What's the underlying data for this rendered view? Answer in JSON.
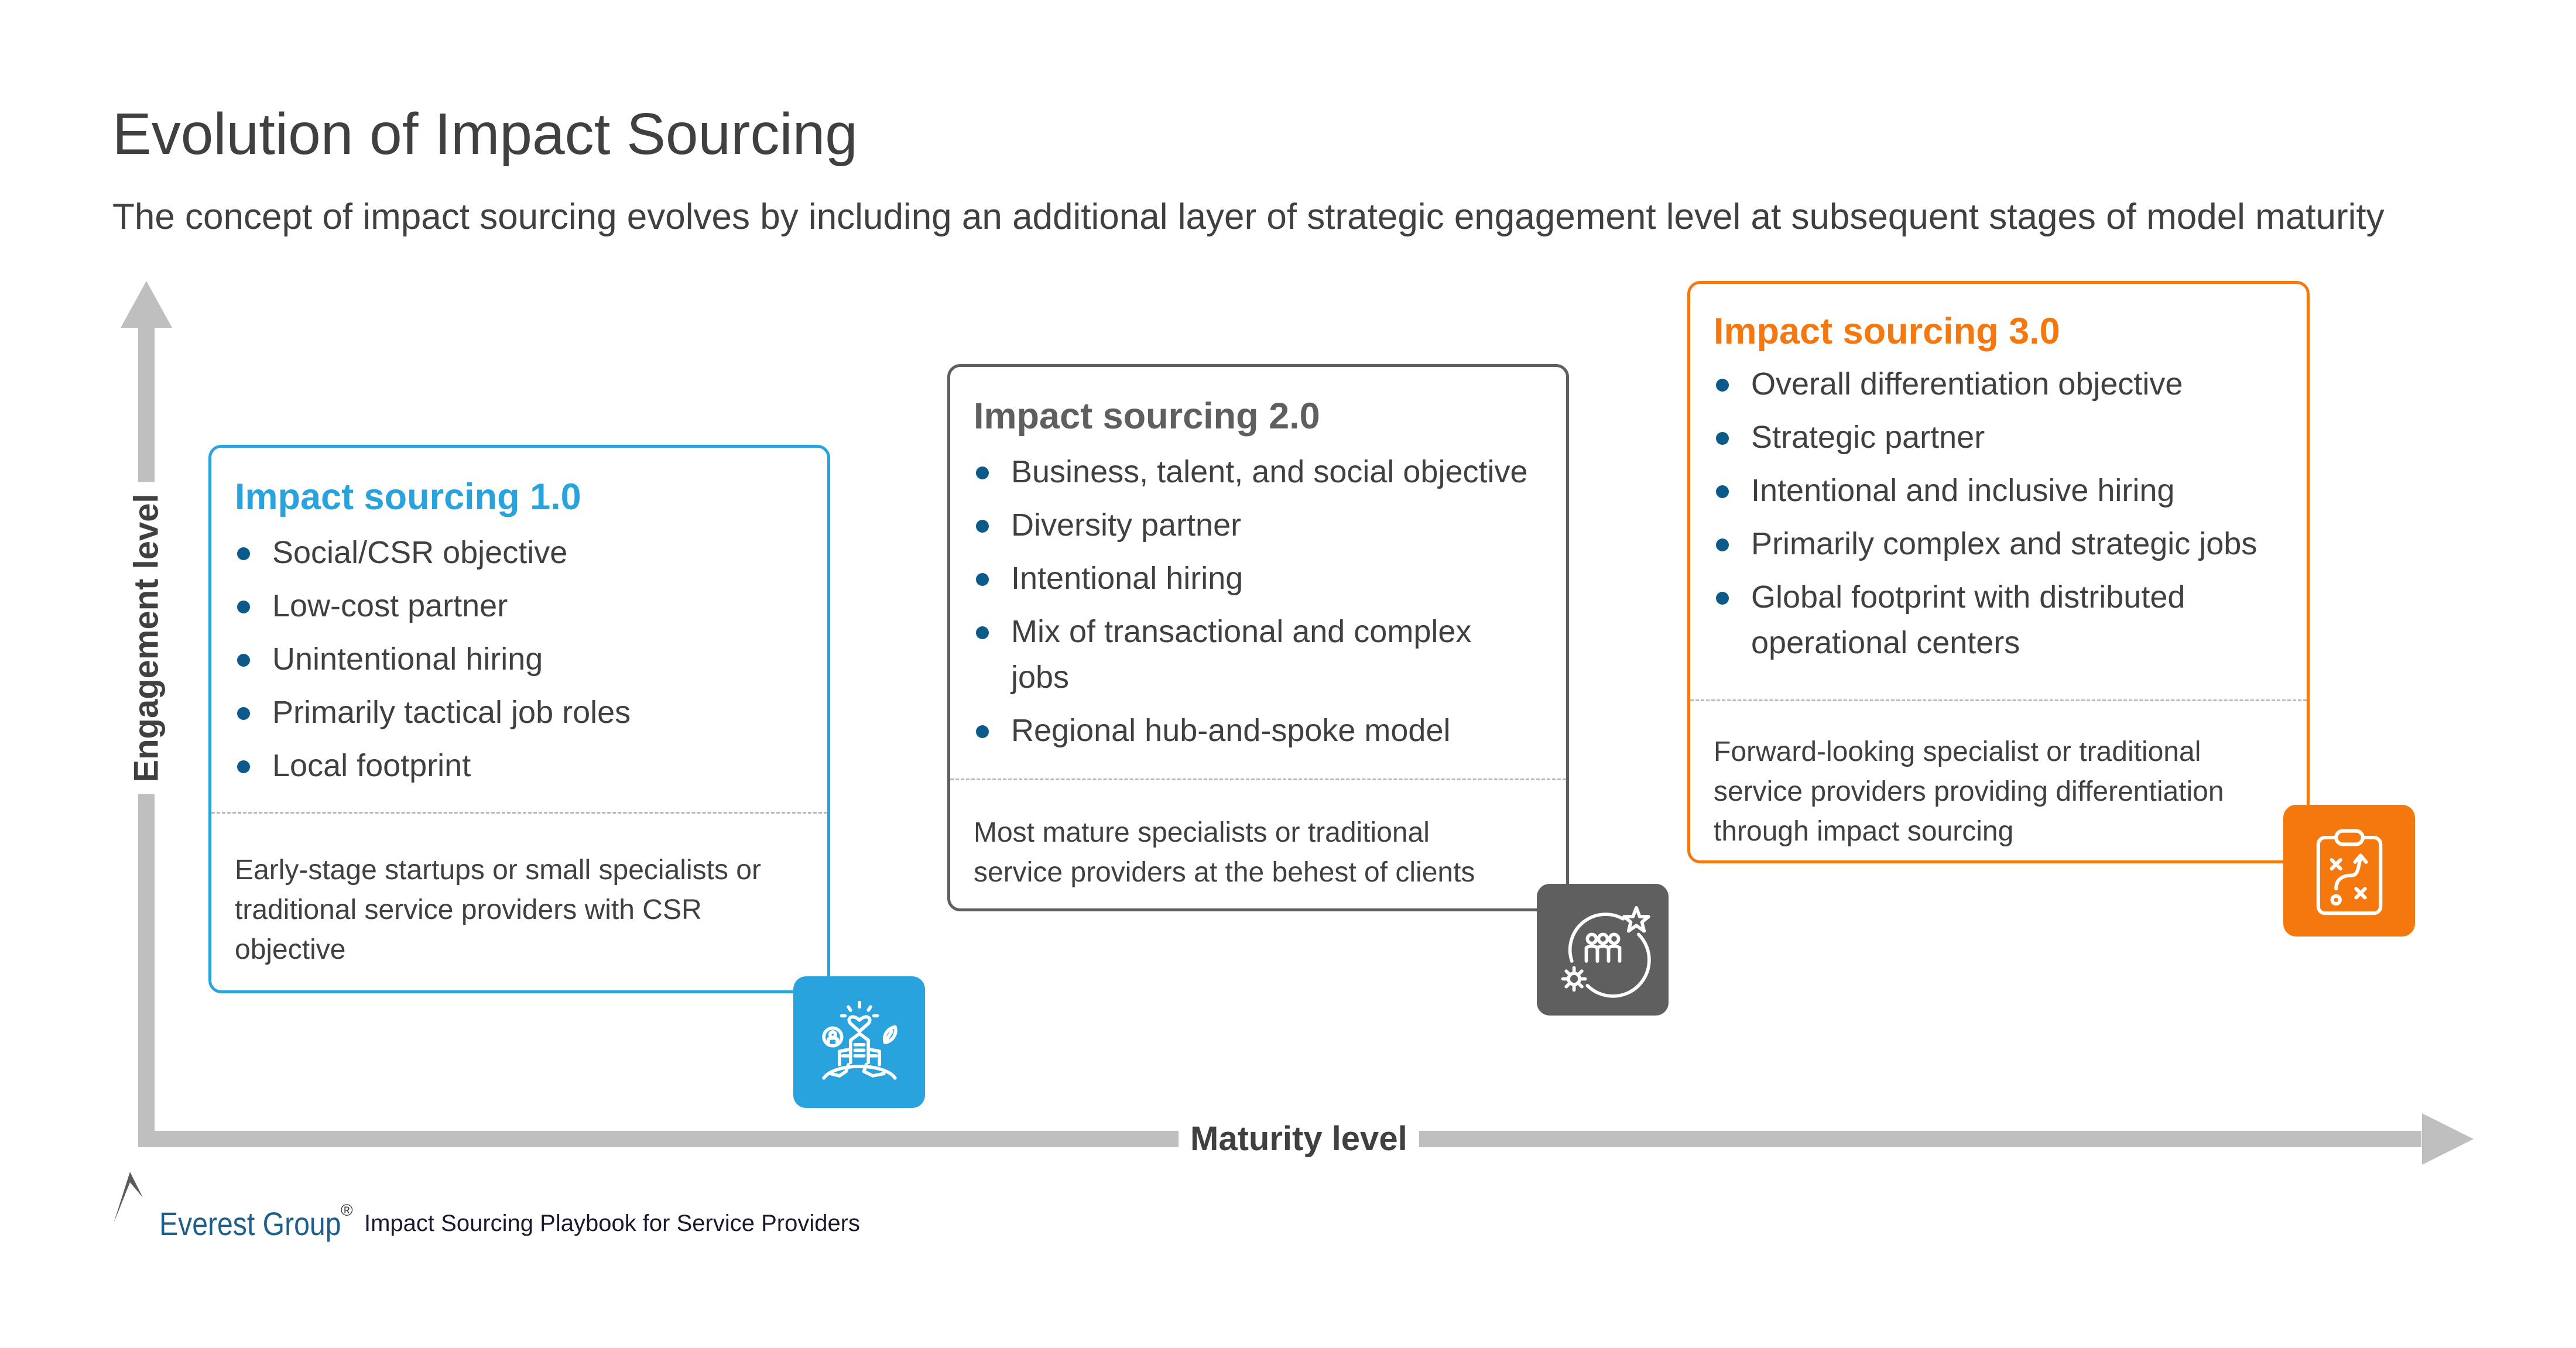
{
  "header": {
    "title": "Evolution of Impact Sourcing",
    "subtitle": "The concept of impact sourcing evolves by including an additional layer of strategic engagement level at subsequent stages of model maturity"
  },
  "axes": {
    "y_label": "Engagement level",
    "x_label": "Maturity level",
    "color": "#bfbfbf"
  },
  "stages": [
    {
      "title": "Impact sourcing 1.0",
      "accent": "#29a3dd",
      "icon": "city-heart-leaf-icon",
      "bullets": [
        "Social/CSR objective",
        "Low-cost partner",
        "Unintentional hiring",
        "Primarily tactical job roles",
        "Local footprint"
      ],
      "description": "Early-stage startups or small specialists or traditional service providers with CSR objective"
    },
    {
      "title": "Impact sourcing 2.0",
      "accent": "#5f5f5f",
      "icon": "team-star-gear-icon",
      "bullets": [
        "Business, talent, and social objective",
        "Diversity partner",
        "Intentional hiring",
        "Mix of transactional and complex jobs",
        "Regional hub-and-spoke model"
      ],
      "description": "Most mature specialists or traditional service providers at the behest of clients"
    },
    {
      "title": "Impact sourcing 3.0",
      "accent": "#f5780f",
      "icon": "clipboard-strategy-icon",
      "bullets": [
        "Overall differentiation objective",
        "Strategic partner",
        "Intentional and inclusive hiring",
        "Primarily complex and strategic jobs",
        "Global footprint with distributed operational centers"
      ],
      "description": "Forward-looking specialist or traditional service providers providing differentiation through impact sourcing"
    }
  ],
  "footer": {
    "brand": "Everest Group",
    "registered": "®",
    "document": "Impact Sourcing Playbook for Service Providers"
  },
  "colors": {
    "text": "#404040",
    "bullet": "#0b5a8a",
    "brand_blue": "#1f5f8c"
  }
}
